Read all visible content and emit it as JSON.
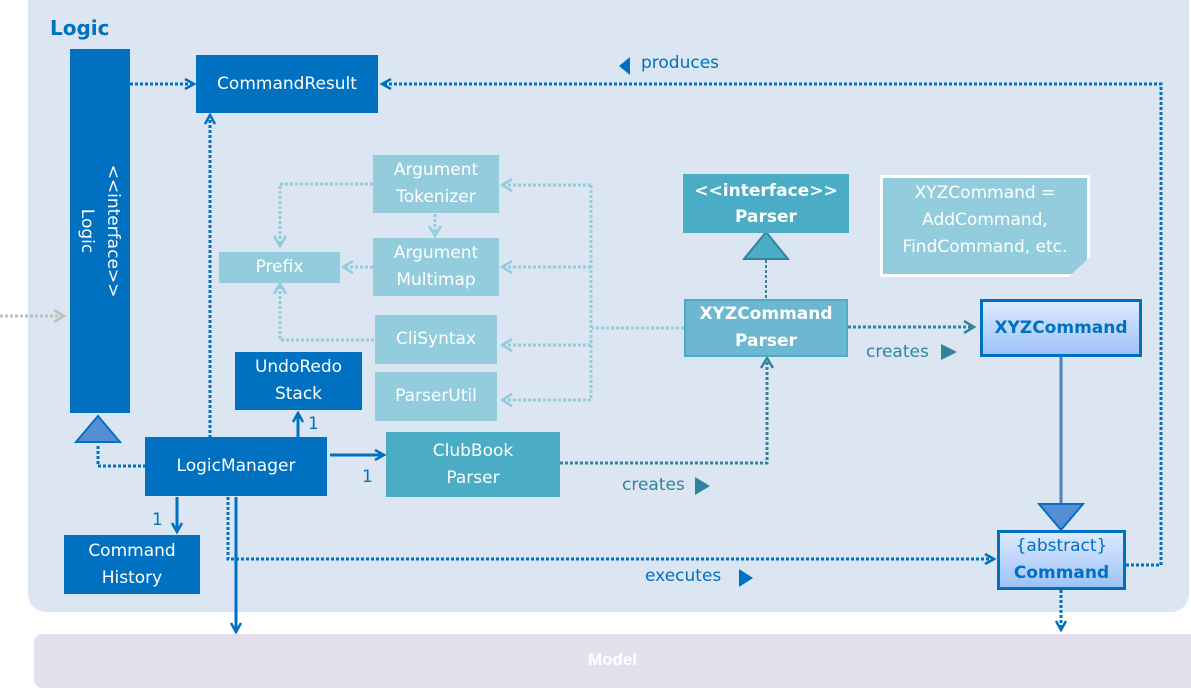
{
  "package": {
    "title": "Logic"
  },
  "external": {
    "model_label": "Model"
  },
  "classes": {
    "logic_interface": {
      "stereotype": "<<interface>>",
      "name": "Logic"
    },
    "command_result": "CommandResult",
    "argument_tokenizer": [
      "Argument",
      "Tokenizer"
    ],
    "argument_multimap": [
      "Argument",
      "Multimap"
    ],
    "prefix": "Prefix",
    "cli_syntax": "CliSyntax",
    "parser_util": "ParserUtil",
    "undo_redo_stack": [
      "UndoRedo",
      "Stack"
    ],
    "logic_manager": "LogicManager",
    "command_history": [
      "Command",
      "History"
    ],
    "clubbook_parser": [
      "ClubBook",
      "Parser"
    ],
    "parser_interface": {
      "stereotype": "<<interface>>",
      "name": "Parser"
    },
    "xyz_command_parser": [
      "XYZCommand",
      "Parser"
    ],
    "xyz_command": "XYZCommand",
    "command": {
      "stereotype": "{abstract}",
      "name": "Command"
    }
  },
  "note": {
    "lines": [
      "XYZCommand =",
      "AddCommand,",
      "FindCommand, etc."
    ]
  },
  "relations": {
    "produces": "produces",
    "creates_parser": "creates",
    "creates_command": "creates",
    "executes": "executes",
    "mult_undo": "1",
    "mult_parser": "1",
    "mult_history": "1"
  },
  "colors": {
    "primary": "#0070c0",
    "light": "#93cddd",
    "teal": "#4bacc6",
    "package_bg": "#dce6f2",
    "model_bg": "#e4dfec"
  }
}
